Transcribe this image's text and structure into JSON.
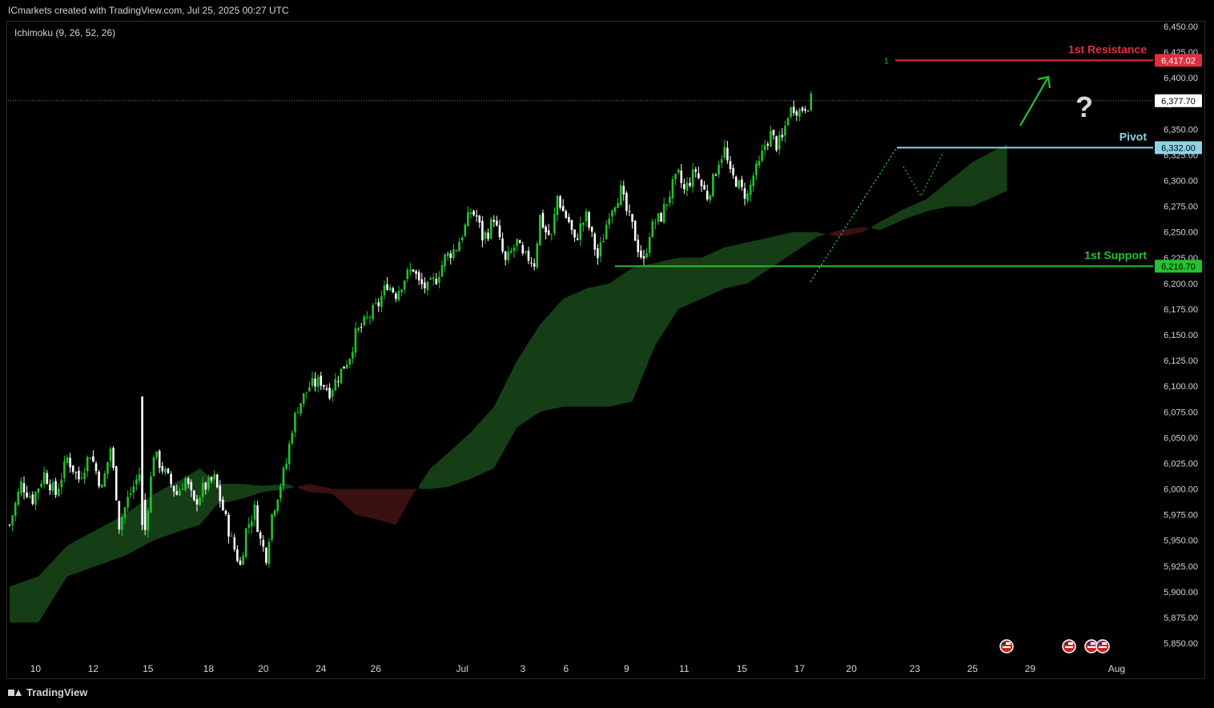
{
  "header": {
    "attribution": "ICmarkets created with TradingView.com, Jul 25, 2025 00:27 UTC",
    "indicator": "Ichimoku (9, 26, 52, 26)"
  },
  "footer": {
    "brand": "TradingView"
  },
  "colors": {
    "bull": "#22c32e",
    "bear": "#ffffff",
    "cloud_bull": "#153d16",
    "cloud_bear": "#3a1010",
    "resistance": "#e03040",
    "pivot": "#8fd3e8",
    "support": "#22c32e"
  },
  "chart_data": {
    "type": "candlestick",
    "ylim": [
      5825,
      6460
    ],
    "y_ticks": [
      "6,450.00",
      "6,425.00",
      "6,400.00",
      "6,375.00",
      "6,350.00",
      "6,325.00",
      "6,300.00",
      "6,275.00",
      "6,250.00",
      "6,225.00",
      "6,200.00",
      "6,175.00",
      "6,150.00",
      "6,125.00",
      "6,100.00",
      "6,075.00",
      "6,050.00",
      "6,025.00",
      "6,000.00",
      "5,975.00",
      "5,950.00",
      "5,925.00",
      "5,900.00",
      "5,875.00",
      "5,850.00"
    ],
    "y_tick_values": [
      6450,
      6425,
      6400,
      6375,
      6350,
      6325,
      6300,
      6275,
      6250,
      6225,
      6200,
      6175,
      6150,
      6125,
      6100,
      6075,
      6050,
      6025,
      6000,
      5975,
      5950,
      5925,
      5900,
      5875,
      5850
    ],
    "x_ticks": [
      {
        "label": "10",
        "bar": 9
      },
      {
        "label": "12",
        "bar": 29
      },
      {
        "label": "15",
        "bar": 48
      },
      {
        "label": "18",
        "bar": 69
      },
      {
        "label": "20",
        "bar": 88
      },
      {
        "label": "24",
        "bar": 108
      },
      {
        "label": "26",
        "bar": 127
      },
      {
        "label": "Jul",
        "bar": 157
      },
      {
        "label": "3",
        "bar": 178
      },
      {
        "label": "6",
        "bar": 193
      },
      {
        "label": "9",
        "bar": 214
      },
      {
        "label": "11",
        "bar": 234
      },
      {
        "label": "15",
        "bar": 254
      },
      {
        "label": "17",
        "bar": 274
      },
      {
        "label": "20",
        "bar": 292
      },
      {
        "label": "23",
        "bar": 314
      },
      {
        "label": "25",
        "bar": 334
      },
      {
        "label": "29",
        "bar": 354
      },
      {
        "label": "Aug",
        "bar": 384
      }
    ],
    "levels": [
      {
        "name": "1st Resistance",
        "value": 6417.02,
        "value_label": "6,417.02",
        "marker": "1"
      },
      {
        "name": "Pivot",
        "value": 6332.0,
        "value_label": "6,332.00"
      },
      {
        "name": "1st Support",
        "value": 6216.7,
        "value_label": "6,216.70"
      }
    ],
    "last_price": {
      "value": 6377.7,
      "label": "6,377.70"
    },
    "annotation": "?",
    "price_path": [
      [
        0,
        5965
      ],
      [
        4,
        6005
      ],
      [
        8,
        5990
      ],
      [
        12,
        6015
      ],
      [
        16,
        5995
      ],
      [
        20,
        6030
      ],
      [
        24,
        6010
      ],
      [
        28,
        6035
      ],
      [
        32,
        6000
      ],
      [
        35,
        6040
      ],
      [
        37,
        5995
      ],
      [
        38,
        5965
      ],
      [
        41,
        5990
      ],
      [
        45,
        6015
      ],
      [
        47,
        5960
      ],
      [
        50,
        6035
      ],
      [
        54,
        6015
      ],
      [
        58,
        5995
      ],
      [
        61,
        6010
      ],
      [
        64,
        5985
      ],
      [
        67,
        6000
      ],
      [
        71,
        6010
      ],
      [
        74,
        5980
      ],
      [
        77,
        5950
      ],
      [
        80,
        5925
      ],
      [
        82,
        5960
      ],
      [
        85,
        5980
      ],
      [
        87,
        5950
      ],
      [
        89,
        5935
      ],
      [
        91,
        5975
      ],
      [
        94,
        6005
      ],
      [
        96,
        6025
      ],
      [
        98,
        6060
      ],
      [
        100,
        6080
      ],
      [
        104,
        6100
      ],
      [
        108,
        6105
      ],
      [
        111,
        6095
      ],
      [
        115,
        6115
      ],
      [
        118,
        6130
      ],
      [
        120,
        6150
      ],
      [
        124,
        6165
      ],
      [
        128,
        6180
      ],
      [
        131,
        6200
      ],
      [
        134,
        6190
      ],
      [
        137,
        6205
      ],
      [
        140,
        6215
      ],
      [
        142,
        6200
      ],
      [
        145,
        6195
      ],
      [
        148,
        6205
      ],
      [
        151,
        6225
      ],
      [
        155,
        6235
      ],
      [
        158,
        6255
      ],
      [
        160,
        6270
      ],
      [
        162,
        6265
      ],
      [
        164,
        6245
      ],
      [
        166,
        6250
      ],
      [
        168,
        6265
      ],
      [
        170,
        6240
      ],
      [
        172,
        6220
      ],
      [
        174,
        6230
      ],
      [
        176,
        6240
      ],
      [
        178,
        6225
      ],
      [
        180,
        6225
      ],
      [
        182,
        6220
      ],
      [
        184,
        6265
      ],
      [
        186,
        6250
      ],
      [
        188,
        6245
      ],
      [
        190,
        6285
      ],
      [
        192,
        6270
      ],
      [
        194,
        6260
      ],
      [
        196,
        6240
      ],
      [
        198,
        6255
      ],
      [
        200,
        6265
      ],
      [
        202,
        6245
      ],
      [
        204,
        6225
      ],
      [
        206,
        6245
      ],
      [
        208,
        6270
      ],
      [
        210,
        6280
      ],
      [
        212,
        6290
      ],
      [
        214,
        6270
      ],
      [
        216,
        6255
      ],
      [
        218,
        6235
      ],
      [
        220,
        6220
      ],
      [
        222,
        6250
      ],
      [
        224,
        6260
      ],
      [
        226,
        6265
      ],
      [
        228,
        6280
      ],
      [
        230,
        6295
      ],
      [
        232,
        6305
      ],
      [
        234,
        6290
      ],
      [
        236,
        6300
      ],
      [
        238,
        6310
      ],
      [
        240,
        6295
      ],
      [
        242,
        6285
      ],
      [
        244,
        6300
      ],
      [
        246,
        6320
      ],
      [
        248,
        6330
      ],
      [
        250,
        6305
      ],
      [
        252,
        6300
      ],
      [
        254,
        6290
      ],
      [
        256,
        6285
      ],
      [
        258,
        6305
      ],
      [
        260,
        6315
      ],
      [
        262,
        6335
      ],
      [
        264,
        6345
      ],
      [
        266,
        6335
      ],
      [
        268,
        6340
      ],
      [
        270,
        6365
      ],
      [
        272,
        6372
      ],
      [
        274,
        6368
      ],
      [
        276,
        6373
      ],
      [
        278,
        6378
      ]
    ],
    "cloud": [
      {
        "i": 0,
        "a": 5905,
        "b": 5870
      },
      {
        "i": 10,
        "a": 5915,
        "b": 5870
      },
      {
        "i": 20,
        "a": 5945,
        "b": 5915
      },
      {
        "i": 30,
        "a": 5960,
        "b": 5925
      },
      {
        "i": 40,
        "a": 5975,
        "b": 5935
      },
      {
        "i": 50,
        "a": 5995,
        "b": 5950
      },
      {
        "i": 60,
        "a": 6010,
        "b": 5960
      },
      {
        "i": 66,
        "a": 6020,
        "b": 5965
      },
      {
        "i": 72,
        "a": 6005,
        "b": 5985
      },
      {
        "i": 80,
        "a": 6005,
        "b": 5990
      },
      {
        "i": 88,
        "a": 6003,
        "b": 5997
      },
      {
        "i": 96,
        "a": 6005,
        "b": 6000
      },
      {
        "i": 104,
        "a": 5997,
        "b": 6005
      },
      {
        "i": 112,
        "a": 5995,
        "b": 6000
      },
      {
        "i": 120,
        "a": 5975,
        "b": 6000
      },
      {
        "i": 128,
        "a": 5970,
        "b": 6000
      },
      {
        "i": 134,
        "a": 5965,
        "b": 6000
      },
      {
        "i": 140,
        "a": 5995,
        "b": 6000
      },
      {
        "i": 146,
        "a": 6020,
        "b": 6000
      },
      {
        "i": 152,
        "a": 6035,
        "b": 6002
      },
      {
        "i": 160,
        "a": 6055,
        "b": 6010
      },
      {
        "i": 168,
        "a": 6080,
        "b": 6020
      },
      {
        "i": 176,
        "a": 6125,
        "b": 6060
      },
      {
        "i": 184,
        "a": 6160,
        "b": 6075
      },
      {
        "i": 192,
        "a": 6185,
        "b": 6080
      },
      {
        "i": 200,
        "a": 6195,
        "b": 6080
      },
      {
        "i": 208,
        "a": 6200,
        "b": 6080
      },
      {
        "i": 216,
        "a": 6215,
        "b": 6085
      },
      {
        "i": 224,
        "a": 6220,
        "b": 6140
      },
      {
        "i": 232,
        "a": 6225,
        "b": 6175
      },
      {
        "i": 240,
        "a": 6225,
        "b": 6185
      },
      {
        "i": 248,
        "a": 6235,
        "b": 6195
      },
      {
        "i": 256,
        "a": 6240,
        "b": 6200
      },
      {
        "i": 264,
        "a": 6245,
        "b": 6215
      },
      {
        "i": 272,
        "a": 6250,
        "b": 6230
      },
      {
        "i": 280,
        "a": 6250,
        "b": 6245
      },
      {
        "i": 288,
        "a": 6245,
        "b": 6252
      },
      {
        "i": 296,
        "a": 6250,
        "b": 6255
      },
      {
        "i": 302,
        "a": 6260,
        "b": 6252
      },
      {
        "i": 310,
        "a": 6272,
        "b": 6262
      },
      {
        "i": 318,
        "a": 6282,
        "b": 6270
      },
      {
        "i": 326,
        "a": 6300,
        "b": 6275
      },
      {
        "i": 334,
        "a": 6318,
        "b": 6275
      },
      {
        "i": 342,
        "a": 6330,
        "b": 6285
      },
      {
        "i": 346,
        "a": 6335,
        "b": 6290
      }
    ]
  }
}
